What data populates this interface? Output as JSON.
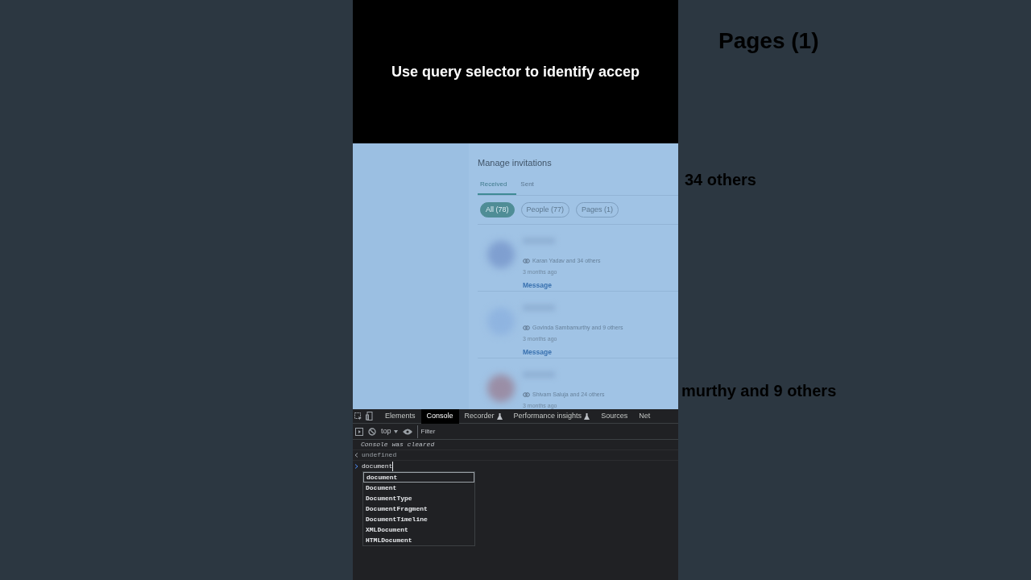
{
  "caption": "Use query selector to identify accep",
  "backdrop": [
    "Pages (1)",
    "34 others",
    "murthy and 9 others"
  ],
  "page": {
    "title": "Manage invitations",
    "tabs": [
      {
        "label": "Received",
        "selected": true
      },
      {
        "label": "Sent",
        "selected": false
      }
    ],
    "filters": [
      {
        "label": "All (78)",
        "selected": true
      },
      {
        "label": "People (77)",
        "selected": false
      },
      {
        "label": "Pages (1)",
        "selected": false
      }
    ],
    "invitations": [
      {
        "mutual": "Karan Yadav and 34 others",
        "time": "3 months ago",
        "action": "Message"
      },
      {
        "mutual": "Govinda Sambamurthy and 9 others",
        "time": "3 months ago",
        "action": "Message"
      },
      {
        "mutual": "Shivam Saluja and 24 others",
        "time": "3 months ago"
      }
    ]
  },
  "devtools": {
    "tabs": [
      {
        "label": "Elements",
        "selected": false,
        "experimental": false
      },
      {
        "label": "Console",
        "selected": true,
        "experimental": false
      },
      {
        "label": "Recorder",
        "selected": false,
        "experimental": true
      },
      {
        "label": "Performance insights",
        "selected": false,
        "experimental": true
      },
      {
        "label": "Sources",
        "selected": false,
        "experimental": false
      },
      {
        "label": "Net",
        "selected": false,
        "experimental": false
      }
    ],
    "context": "top",
    "filter_placeholder": "Filter",
    "console": [
      {
        "kind": "info",
        "text": "Console was cleared"
      },
      {
        "kind": "result",
        "text": "undefined"
      },
      {
        "kind": "input",
        "text": "document"
      }
    ],
    "suggestions": [
      {
        "label": "document",
        "selected": true
      },
      {
        "label": "Document",
        "selected": false
      },
      {
        "label": "DocumentType",
        "selected": false
      },
      {
        "label": "DocumentFragment",
        "selected": false
      },
      {
        "label": "DocumentTimeline",
        "selected": false
      },
      {
        "label": "XMLDocument",
        "selected": false
      },
      {
        "label": "HTMLDocument",
        "selected": false
      }
    ]
  }
}
